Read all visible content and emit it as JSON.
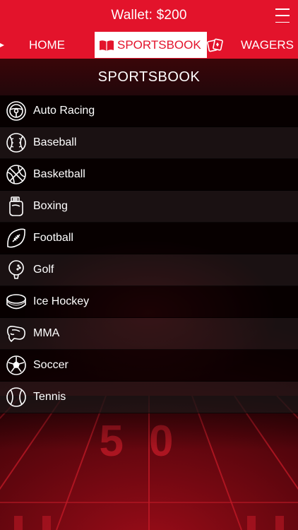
{
  "header": {
    "wallet_text": "Wallet: $200"
  },
  "nav": {
    "home_label": "HOME",
    "sportsbook_label": "SPORTSBOOK",
    "wagers_label": "WAGERS"
  },
  "section": {
    "title": "SPORTSBOOK"
  },
  "sports": [
    {
      "label": "Auto Racing",
      "icon": "steering-wheel-icon"
    },
    {
      "label": "Baseball",
      "icon": "baseball-icon"
    },
    {
      "label": "Basketball",
      "icon": "basketball-icon"
    },
    {
      "label": "Boxing",
      "icon": "boxing-glove-icon"
    },
    {
      "label": "Football",
      "icon": "football-icon"
    },
    {
      "label": "Golf",
      "icon": "golf-ball-icon"
    },
    {
      "label": "Ice Hockey",
      "icon": "hockey-puck-icon"
    },
    {
      "label": "MMA",
      "icon": "mma-glove-icon"
    },
    {
      "label": "Soccer",
      "icon": "soccer-ball-icon"
    },
    {
      "label": "Tennis",
      "icon": "tennis-ball-icon"
    }
  ],
  "background": {
    "field_marker": "50"
  },
  "colors": {
    "brand_red": "#e3132b",
    "text": "#ffffff"
  }
}
